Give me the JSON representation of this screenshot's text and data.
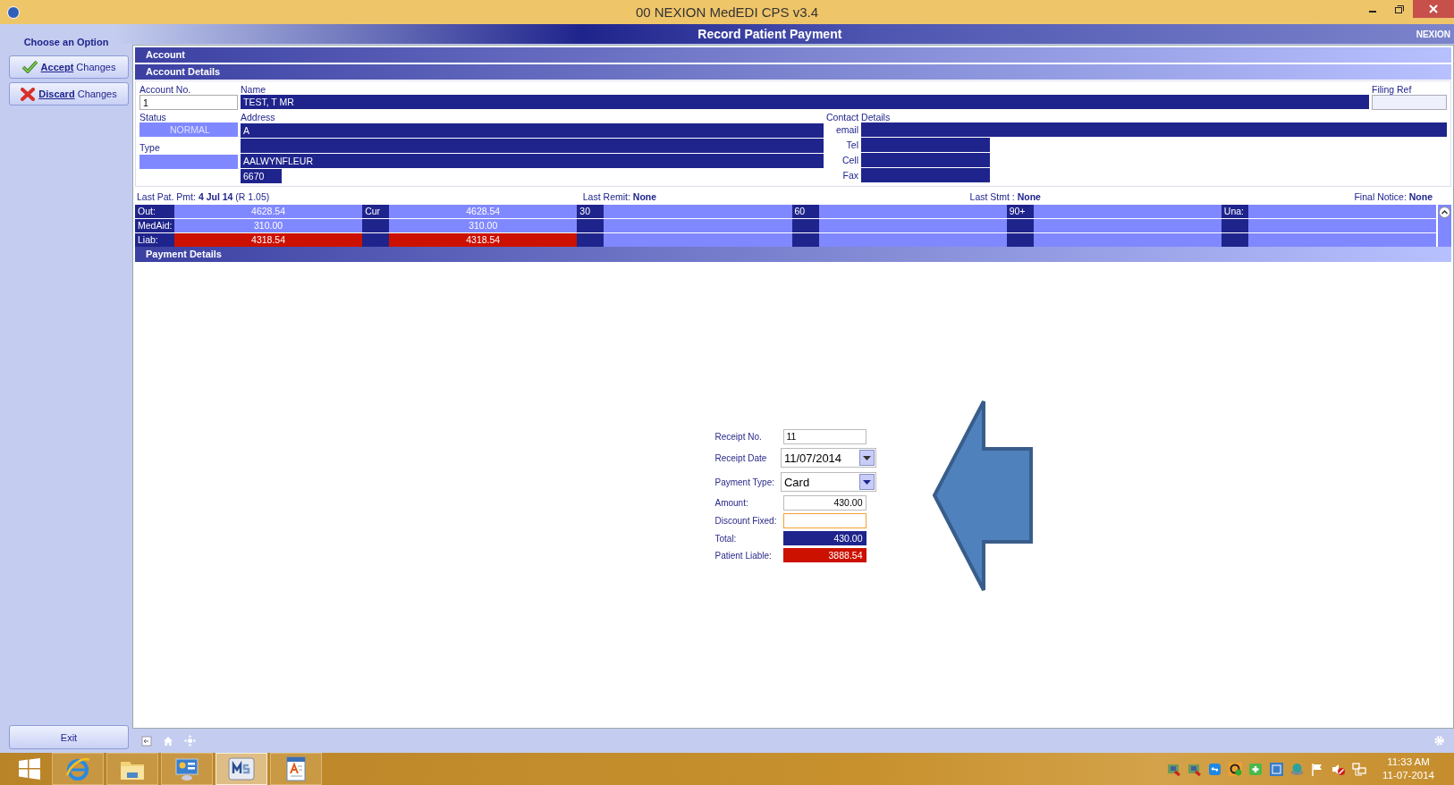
{
  "window": {
    "title": "00 NEXION MedEDI CPS v3.4"
  },
  "sidebar": {
    "heading": "Choose an Option",
    "buttons": [
      {
        "label": "**Accept** Changes",
        "kind": "accept"
      },
      {
        "label": "**Discard** Changes",
        "kind": "discard"
      }
    ],
    "exit": "Exit"
  },
  "header": {
    "title": "Record Patient Payment",
    "brand": "NEXION"
  },
  "sections": [
    "Account",
    "Account Details"
  ],
  "account": {
    "account_no": {
      "label": "Account No.",
      "value": "1"
    },
    "name": {
      "label": "Name",
      "value": "TEST, T MR"
    },
    "filing_ref": {
      "label": "Filing Ref"
    },
    "status": {
      "label": "Status",
      "value": "NORMAL"
    },
    "type": {
      "label": "Type"
    },
    "address": {
      "label": "Address",
      "line_1": "A",
      "line_3": "AALWYNFLEUR",
      "postcode": "6670"
    },
    "contact": {
      "label": "Contact Details",
      "fields": [
        {
          "label": "email",
          "wide": true
        },
        {
          "label": "Tel",
          "wide": false
        },
        {
          "label": "Cell",
          "wide": false
        },
        {
          "label": "Fax",
          "wide": false
        }
      ]
    }
  },
  "summary": [
    "Last Pat. Pmt: **4 Jul 14** (R 1.05)",
    "Last Remit: **None**",
    "Last Stmt : **None**",
    "Final Notice: **None**"
  ],
  "aging": {
    "headers": [
      "Cur",
      "30",
      "60",
      "90+",
      "Una:"
    ],
    "rows": [
      {
        "label": "Out:",
        "kind": "normal",
        "values": [
          "4628.54",
          "4628.54"
        ]
      },
      {
        "label": "MedAid:",
        "kind": "normal",
        "values": [
          "310.00",
          "310.00"
        ]
      },
      {
        "label": "Liab:",
        "kind": "liability",
        "values": [
          "4318.54",
          "4318.54"
        ]
      }
    ]
  },
  "payment": {
    "title": "Payment Details",
    "fields": [
      {
        "label": "Receipt No.",
        "value": "11",
        "kind": "input",
        "focused": false
      },
      {
        "label": "Receipt Date",
        "value": "11/07/2014",
        "kind": "date",
        "focused": false
      },
      {
        "label": "Payment Type:",
        "value": "Card",
        "kind": "dropdown",
        "focused": false
      },
      {
        "label": "Amount:",
        "value": "430.00",
        "kind": "amount",
        "focused": false
      },
      {
        "label": "Discount Fixed:",
        "kind": "amount",
        "focused": true
      },
      {
        "label": "Total:",
        "value": "430.00",
        "kind": "total",
        "focused": false
      },
      {
        "label": "Patient Liable:",
        "value": "3888.54",
        "kind": "liable",
        "focused": false
      }
    ]
  },
  "taskbar": {
    "apps": [
      {
        "kind": "browser",
        "selected": false
      },
      {
        "kind": "folder",
        "selected": false
      },
      {
        "kind": "control",
        "selected": false
      },
      {
        "kind": "ms",
        "selected": true
      },
      {
        "kind": "document",
        "selected": false
      }
    ],
    "time": "11:33 AM",
    "date": "11-07-2014"
  }
}
